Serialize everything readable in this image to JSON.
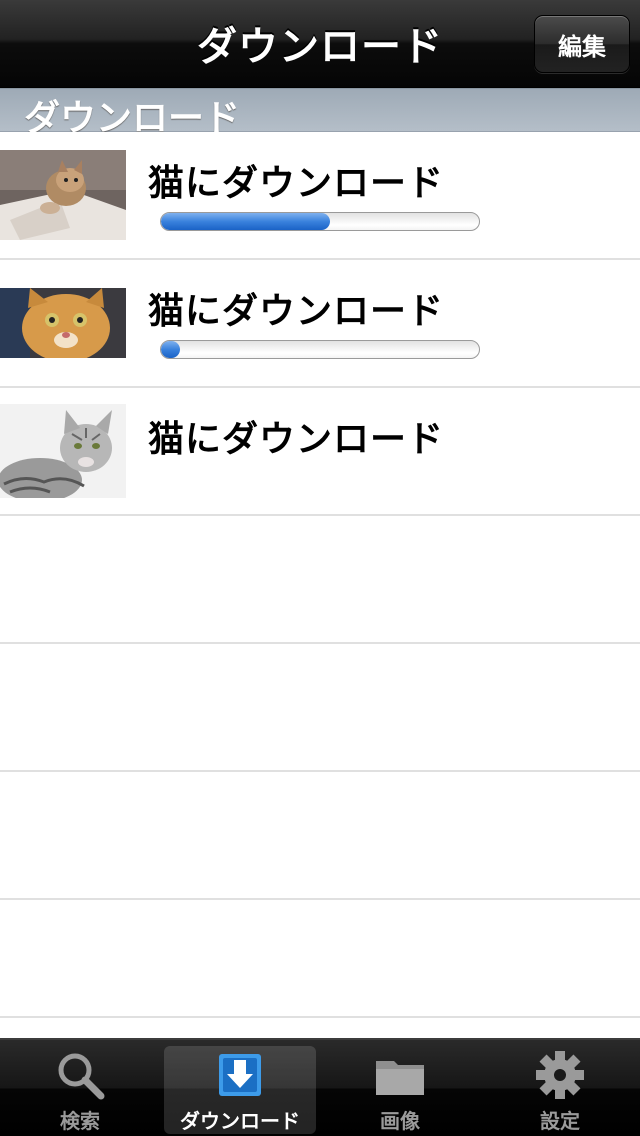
{
  "nav": {
    "title": "ダウンロード",
    "edit_label": "編集"
  },
  "section": {
    "title": "ダウンロード"
  },
  "downloads": [
    {
      "title": "猫にダウンロード",
      "progress": 0.53,
      "thumb": "cat-on-laptop"
    },
    {
      "title": "猫にダウンロード",
      "progress": 0.06,
      "thumb": "orange-cat-face"
    },
    {
      "title": "猫にダウンロード",
      "progress": null,
      "thumb": "gray-tabby-cat"
    }
  ],
  "tabs": [
    {
      "label": "検索",
      "icon": "search-icon",
      "selected": false
    },
    {
      "label": "ダウンロード",
      "icon": "download-icon",
      "selected": true
    },
    {
      "label": "画像",
      "icon": "folder-icon",
      "selected": false
    },
    {
      "label": "設定",
      "icon": "gear-icon",
      "selected": false
    }
  ],
  "colors": {
    "accent": "#3a82dd",
    "navbar": "#1a1a1a",
    "section": "#aab5c0"
  }
}
